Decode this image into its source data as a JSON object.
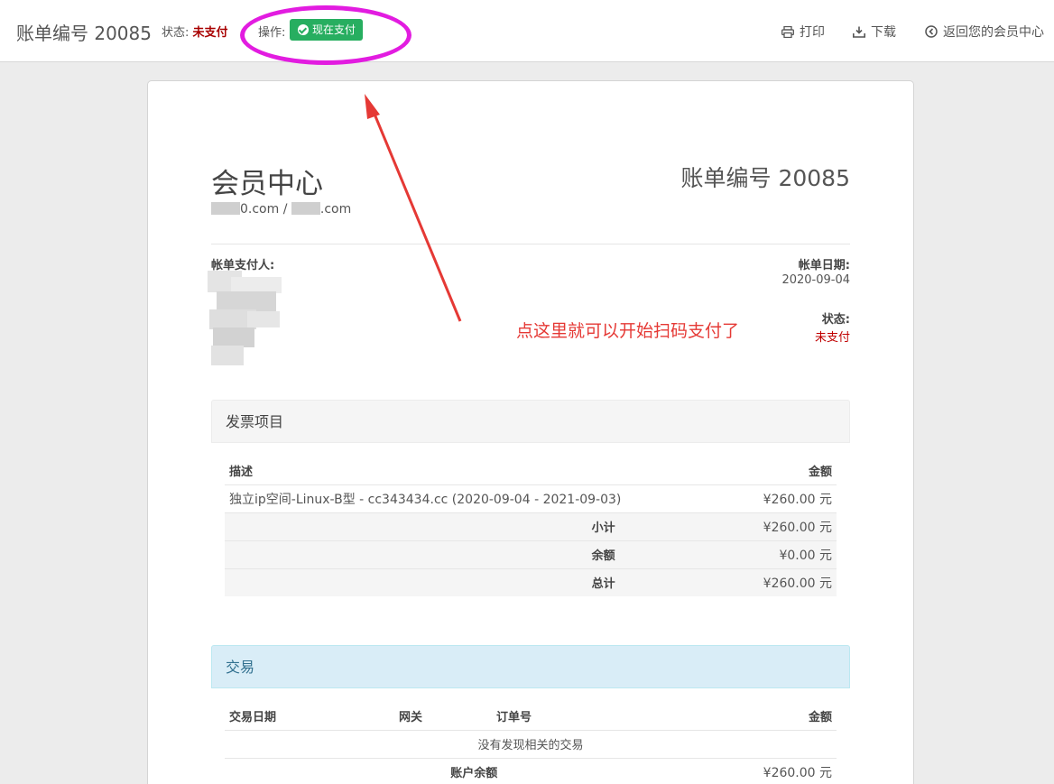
{
  "topbar": {
    "invoice_title": "账单编号 20085",
    "status_label": "状态:",
    "status_value": "未支付",
    "action_label": "操作:",
    "pay_button": "现在支付",
    "print": "打印",
    "download": "下载",
    "back": "返回您的会员中心"
  },
  "annotation": {
    "note": "点这里就可以开始扫码支付了"
  },
  "invoice": {
    "company": "会员中心",
    "domain1_suffix": "0.com",
    "domain_sep": " / ",
    "domain2_suffix": ".com",
    "invoice_no": "账单编号 20085",
    "payer_label": "帐单支付人:",
    "date_label": "帐单日期:",
    "date_value": "2020-09-04",
    "status_label": "状态:",
    "status_value": "未支付"
  },
  "items": {
    "title": "发票项目",
    "col_desc": "描述",
    "col_amount": "金额",
    "rows": [
      {
        "desc": "独立ip空间-Linux-B型 - cc343434.cc (2020-09-04 - 2021-09-03)",
        "amount": "¥260.00 元"
      }
    ],
    "subtotal_label": "小计",
    "subtotal_value": "¥260.00 元",
    "balance_label": "余额",
    "balance_value": "¥0.00 元",
    "total_label": "总计",
    "total_value": "¥260.00 元"
  },
  "transactions": {
    "title": "交易",
    "col_date": "交易日期",
    "col_gateway": "网关",
    "col_order": "订单号",
    "col_amount": "金额",
    "empty": "没有发现相关的交易",
    "balance_label": "账户余额",
    "balance_value": "¥260.00 元"
  },
  "colors": {
    "pay_button": "#27ae60",
    "unpaid": "#a80000",
    "annotation_ring": "#e21ce0",
    "annotation_arrow": "#e53935",
    "transactions_head": "#d9edf7"
  }
}
